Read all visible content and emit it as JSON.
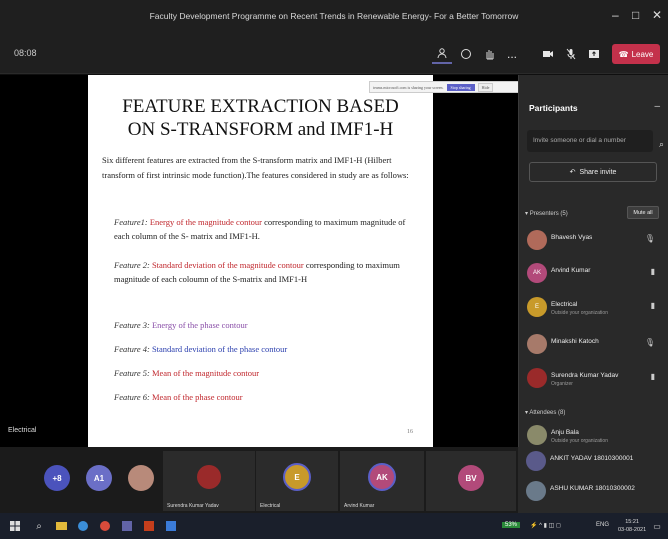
{
  "window": {
    "title": "Faculty Development Programme on Recent Trends in Renewable Energy- For a Better Tomorrow",
    "minimize": "–",
    "maximize": "□",
    "close": "✕"
  },
  "toolbar": {
    "timer": "08:08",
    "more": "...",
    "leave_label": "Leave"
  },
  "share_bar": {
    "text": "teams.microsoft.com is sharing your screen.",
    "stop_label": "Stop sharing",
    "hide_label": "Hide"
  },
  "slide": {
    "title": "FEATURE EXTRACTION BASED ON S-TRANSFORM and IMF1-H",
    "intro": "Six different features are extracted from the S-transform matrix and IMF1-H (Hilbert transform of first intrinsic mode function).The features considered in study are as follows:",
    "features": [
      {
        "label": "Feature1:",
        "highlight": "Energy of the magnitude contour",
        "rest": " corresponding to maximum magnitude of each column of the S- matrix and IMF1-H."
      },
      {
        "label": "Feature 2:",
        "highlight": "Standard deviation of the magnitude contour",
        "rest": " corresponding to maximum magnitude of each coloumn of the S-matrix and IMF1-H"
      },
      {
        "label": "Feature 3:",
        "highlight": "Energy of the phase contour",
        "rest": ""
      },
      {
        "label": "Feature 4:",
        "highlight": "Standard deviation of the phase contour",
        "rest": ""
      },
      {
        "label": "Feature 5:",
        "highlight": "Mean of the magnitude contour",
        "rest": ""
      },
      {
        "label": "Feature 6:",
        "highlight": "Mean of the phase contour",
        "rest": ""
      }
    ],
    "page_number": "16"
  },
  "stage_label": "Electrical",
  "panel": {
    "title": "Participants",
    "invite_placeholder": "Invite someone or dial a number",
    "share_invite": "Share invite",
    "presenters_header": "Presenters (5)",
    "mute_all": "Mute all",
    "attendees_header": "Attendees (8)",
    "presenters": [
      {
        "name": "Bhavesh Vyas",
        "sub": "",
        "initials": "",
        "color": "#b06a5a"
      },
      {
        "name": "Arvind Kumar",
        "sub": "",
        "initials": "AK",
        "color": "#b24a7a"
      },
      {
        "name": "Electrical",
        "sub": "Outside your organization",
        "initials": "E",
        "color": "#c89a2a"
      },
      {
        "name": "Minakshi Katoch",
        "sub": "",
        "initials": "",
        "color": "#a77a6a"
      },
      {
        "name": "Surendra Kumar Yadav",
        "sub": "Organizer",
        "initials": "",
        "color": "#9a2a2a"
      }
    ],
    "attendees": [
      {
        "name": "Anju Bala",
        "sub": "Outside your organization",
        "initials": "AB",
        "color": "#8a8a6a"
      },
      {
        "name": "ANKIT YADAV 18010300001",
        "sub": "",
        "initials": "",
        "color": "#5a5a8a"
      },
      {
        "name": "ASHU KUMAR 18010300002",
        "sub": "",
        "initials": "",
        "color": "#6a7a8a"
      }
    ]
  },
  "gallery": [
    {
      "initials": "+8",
      "name": "",
      "color": "#4b53bc"
    },
    {
      "initials": "A1",
      "name": "",
      "color": "#6b6fc7"
    },
    {
      "initials": "",
      "name": "",
      "color": "#b88a7a"
    },
    {
      "initials": "",
      "name": "Surendra Kumar Yadav",
      "color": "#9a2a2a"
    },
    {
      "initials": "E",
      "name": "Electrical",
      "color": "#c89a2a"
    },
    {
      "initials": "AK",
      "name": "Arvind Kumar",
      "color": "#b24a7a"
    },
    {
      "initials": "BV",
      "name": "",
      "color": "#b24a7a"
    }
  ],
  "taskbar": {
    "time": "15:21",
    "date": "03-08-2021",
    "lang": "ENG",
    "battery": "53%"
  }
}
